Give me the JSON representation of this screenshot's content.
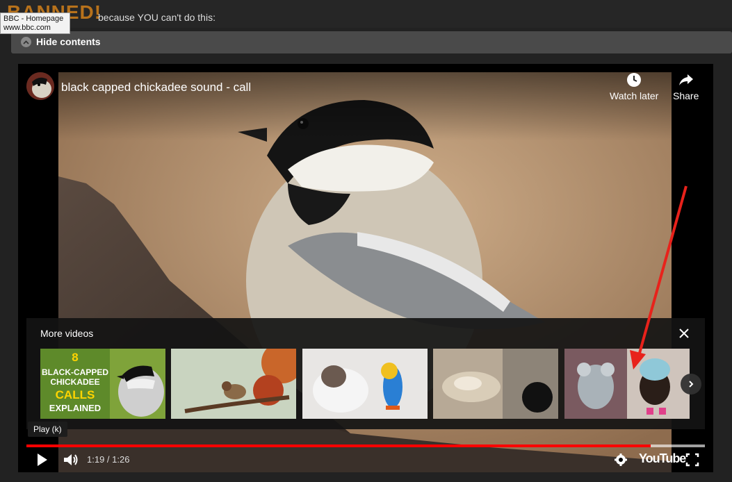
{
  "page": {
    "banner": "BANNED!",
    "tagline": "because YOU can't do this:",
    "tooltip": {
      "title": "BBC - Homepage",
      "url": "www.bbc.com"
    },
    "hide_contents": "Hide contents"
  },
  "player": {
    "title": "black capped chickadee sound - call",
    "watch_later": "Watch later",
    "share": "Share",
    "more_videos": {
      "heading": "More videos",
      "thumbnails": [
        {
          "name": "thumb-chickadee-calls",
          "text_lines": [
            "8",
            "BLACK-CAPPED",
            "CHICKADEE",
            "CALLS",
            "EXPLAINED"
          ]
        },
        {
          "name": "thumb-sparrow"
        },
        {
          "name": "thumb-cat-parrot"
        },
        {
          "name": "thumb-cats-bed"
        },
        {
          "name": "thumb-koala-puppy"
        }
      ]
    },
    "tooltip_play": "Play (k)",
    "time_current": "1:19",
    "time_sep": " / ",
    "time_total": "1:26",
    "progress_played": 0.92,
    "progress_loaded": 1.0,
    "logo": "YouTube"
  },
  "colors": {
    "banner": "#b8721b",
    "progress": "#ff0000",
    "annotation": "#e8221b"
  }
}
